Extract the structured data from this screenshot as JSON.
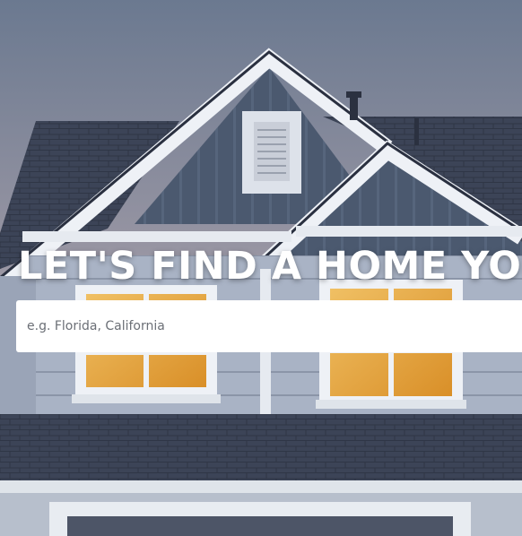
{
  "hero": {
    "headline": "LET'S FIND A HOME YOU'LL LOVE",
    "image_subject": "house-exterior-dusk"
  },
  "search": {
    "placeholder": "e.g. Florida, California"
  },
  "colors": {
    "sky_top": "#6d7b92",
    "sky_horizon": "#c9b4ad",
    "roof": "#3a4255",
    "siding_upper": "#4a586e",
    "siding_lower": "#aab4c6",
    "trim": "#eef1f6",
    "window_glow": "#e6a842"
  }
}
